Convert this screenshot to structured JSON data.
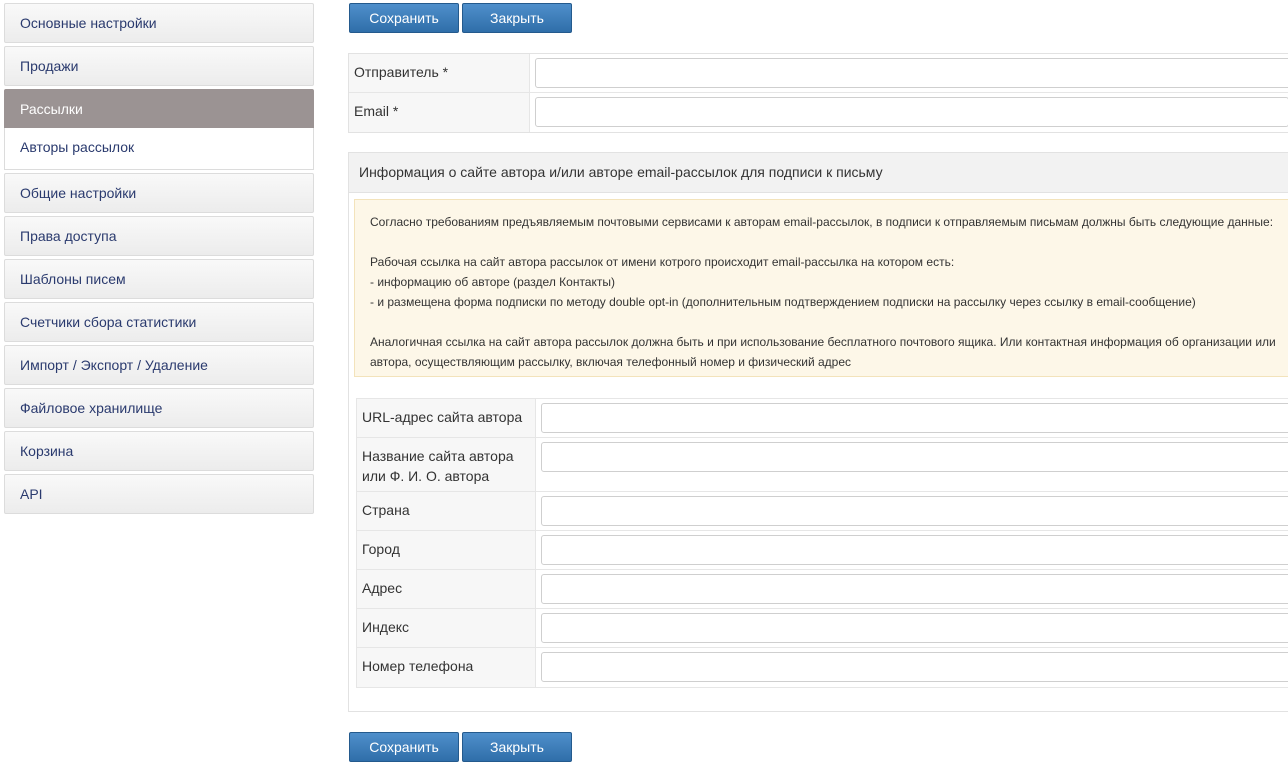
{
  "sidebar": {
    "items": [
      {
        "label": "Основные настройки"
      },
      {
        "label": "Продажи"
      },
      {
        "label": "Рассылки"
      },
      {
        "label": "Авторы рассылок"
      },
      {
        "label": "Общие настройки"
      },
      {
        "label": "Права доступа"
      },
      {
        "label": "Шаблоны писем"
      },
      {
        "label": "Счетчики сбора статистики"
      },
      {
        "label": "Импорт / Экспорт / Удаление"
      },
      {
        "label": "Файловое хранилище"
      },
      {
        "label": "Корзина"
      },
      {
        "label": "API"
      }
    ]
  },
  "toolbar": {
    "save_label": "Сохранить",
    "close_label": "Закрыть"
  },
  "sender_form": {
    "sender_label": "Отправитель *",
    "sender_value": "",
    "email_label": "Email *",
    "email_value": ""
  },
  "author_info": {
    "heading": "Информация о сайте автора и/или авторе email-рассылок для подписи к письму",
    "notice": {
      "line1": "Согласно требованиям предъявляемым почтовыми сервисами к авторам email-рассылок, в подписи к отправляемым письмам должны быть следующие данные:",
      "line2": "Рабочая ссылка на сайт автора рассылок от имени котрого происходит email-рассылка на котором есть:",
      "line3": "- информацию об авторе (раздел Контакты)",
      "line4": "- и размещена форма подписки по методу double opt-in (дополнительным подтверждением подписки на рассылку через ссылку в email-сообщение)",
      "line5": "Аналогичная ссылка на сайт автора рассылок должна быть и при использование бесплатного почтового ящика. Или контактная информация об организации или автора, осуществляющим рассылку, включая телефонный номер и физический адрес"
    },
    "fields": [
      {
        "label": "URL-адрес сайта автора",
        "value": ""
      },
      {
        "label": "Название сайта автора или Ф. И. О. автора",
        "value": ""
      },
      {
        "label": "Страна",
        "value": ""
      },
      {
        "label": "Город",
        "value": ""
      },
      {
        "label": "Адрес",
        "value": ""
      },
      {
        "label": "Индекс",
        "value": ""
      },
      {
        "label": "Номер телефона",
        "value": ""
      }
    ]
  },
  "colors": {
    "active_nav": "#9b9393",
    "button": "#3a7ab8",
    "nav_text": "#2a3a6e",
    "notice_bg": "#fdf7e8"
  }
}
